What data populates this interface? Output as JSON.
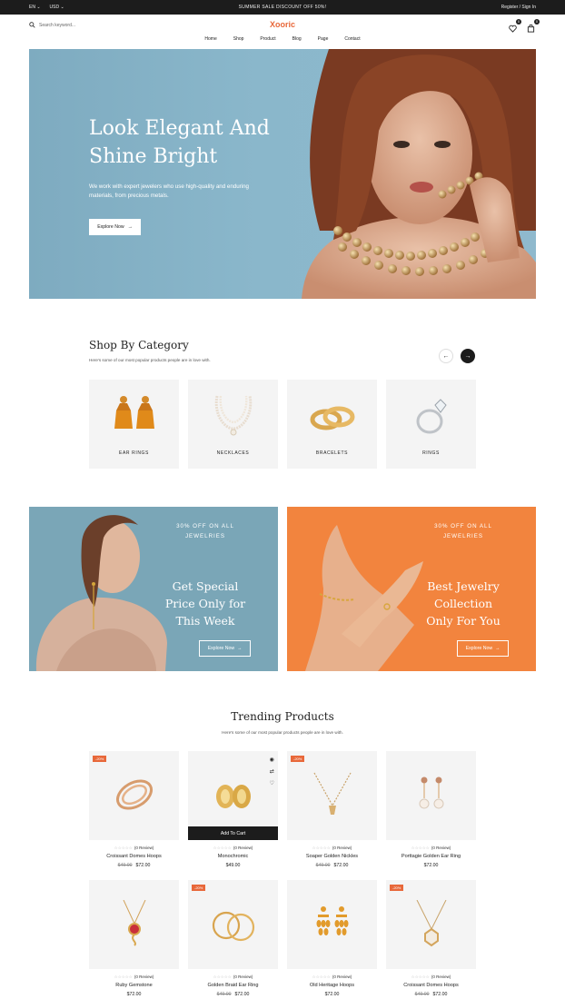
{
  "topbar": {
    "lang": "EN",
    "currency": "USD",
    "promo": "SUMMER SALE DISCOUNT OFF 50%!",
    "auth": "Register / Sign In"
  },
  "header": {
    "search_placeholder": "Search keyword...",
    "logo": "Xooric",
    "wishlist_count": "0",
    "cart_count": "0"
  },
  "nav": [
    "Home",
    "Shop",
    "Product",
    "Blog",
    "Page",
    "Contact"
  ],
  "hero": {
    "title_line1": "Look Elegant And",
    "title_line2": "Shine Bright",
    "subtitle_line1": "We work with expert jewelers who use high-quality and enduring",
    "subtitle_line2": "materials, from precious metals.",
    "button": "Explore Now"
  },
  "category": {
    "title": "Shop By Category",
    "subtitle": "Here's some of our most popular products people are in love with.",
    "items": [
      "EAR RINGS",
      "NECKLACES",
      "BRACELETS",
      "RINGS"
    ]
  },
  "promos": [
    {
      "tag_line1": "30% OFF ON ALL",
      "tag_line2": "JEWELRIES",
      "heading_line1": "Get Special",
      "heading_line2": "Price Only for",
      "heading_line3": "This Week",
      "button": "Explore Now"
    },
    {
      "tag_line1": "30% OFF ON ALL",
      "tag_line2": "JEWELRIES",
      "heading_line1": "Best Jewelry",
      "heading_line2": "Collection",
      "heading_line3": "Only For You",
      "button": "Explore Now"
    }
  ],
  "trending": {
    "title": "Trending Products",
    "subtitle": "Here's some of our most popular products people are in love with.",
    "add_to_cart": "Add To Cart",
    "products": [
      {
        "name": "Croissant Domes Hoops",
        "old_price": "$49.00",
        "price": "$72.00",
        "reviews": "(0 Review)",
        "badge": "-20%"
      },
      {
        "name": "Monochromic",
        "old_price": "",
        "price": "$49.00",
        "reviews": "(0 Review)",
        "badge": ""
      },
      {
        "name": "Soaper Golden Nickles",
        "old_price": "$49.00",
        "price": "$72.00",
        "reviews": "(0 Review)",
        "badge": "-20%"
      },
      {
        "name": "Porttagie Golden Ear Ring",
        "old_price": "",
        "price": "$72.00",
        "reviews": "(0 Review)",
        "badge": ""
      },
      {
        "name": "Ruby Gemstone",
        "old_price": "",
        "price": "$72.00",
        "reviews": "(0 Review)",
        "badge": ""
      },
      {
        "name": "Golden Braid Ear Ring",
        "old_price": "$49.00",
        "price": "$72.00",
        "reviews": "(0 Review)",
        "badge": "-20%"
      },
      {
        "name": "Old Heritage Hoops",
        "old_price": "",
        "price": "$72.00",
        "reviews": "(0 Review)",
        "badge": ""
      },
      {
        "name": "Croissant Domes Hoops",
        "old_price": "$49.00",
        "price": "$72.00",
        "reviews": "(0 Review)",
        "badge": "-20%"
      }
    ]
  },
  "colors": {
    "accent": "#e8683a",
    "dark": "#1c1c1c",
    "hero_bg": "#8ab7cb",
    "promo_orange": "#f2843e",
    "card_bg": "#f4f4f4"
  }
}
